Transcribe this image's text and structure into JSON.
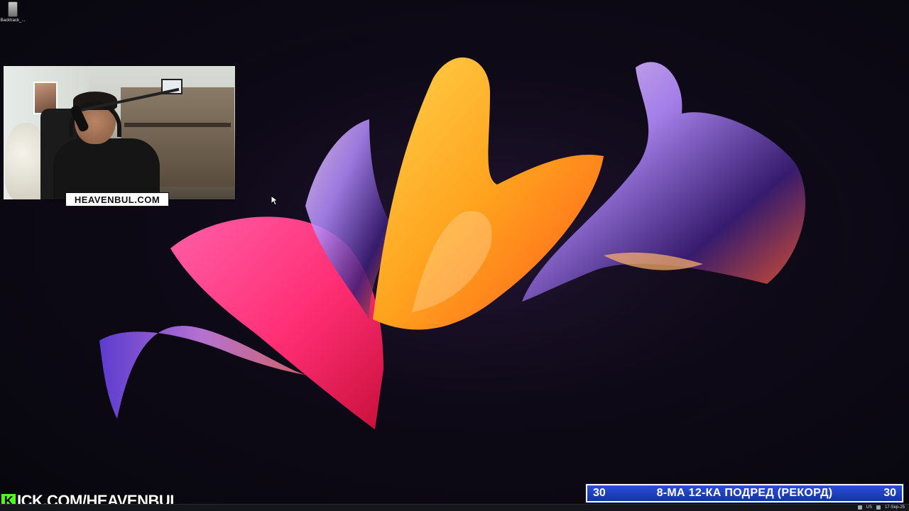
{
  "desktop": {
    "icons": [
      {
        "label": "Backtrack_...",
        "icon": "app-shortcut-icon"
      }
    ]
  },
  "webcam": {
    "channel_tag": "HEAVENBUL.COM"
  },
  "overlay": {
    "kick_url": "ICK.COM/HEAVENBUL",
    "kick_logo_letter": "K",
    "kick_color": "#53fc18",
    "counter": {
      "left_value": "30",
      "text": "8-МА 12-КА ПОДРЕД (РЕКОРД)",
      "right_value": "30",
      "bg_color": "#1e40c4"
    }
  },
  "taskbar": {
    "tray": {
      "language": "US",
      "date": "17-Sep-25"
    }
  }
}
